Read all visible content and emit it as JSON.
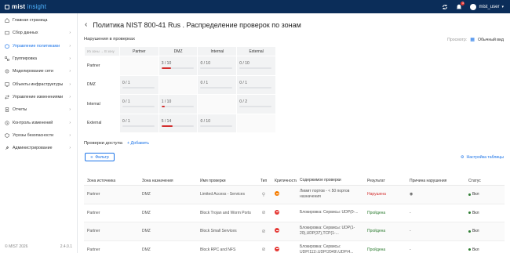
{
  "app": {
    "name": "mist",
    "name_accent": "insight"
  },
  "user": {
    "name": "mist_user",
    "notifications": "3"
  },
  "sidebar": {
    "items": [
      {
        "label": "Главная страница",
        "icon": "home-icon",
        "chevron": false
      },
      {
        "label": "Сбор данных",
        "icon": "download-icon",
        "chevron": true
      },
      {
        "label": "Управление политиками",
        "icon": "policy-icon",
        "chevron": true,
        "active": true
      },
      {
        "label": "Группировка",
        "icon": "group-icon",
        "chevron": true
      },
      {
        "label": "Моделирование сети",
        "icon": "network-icon",
        "chevron": true
      },
      {
        "label": "Объекты инфраструктуры",
        "icon": "infrastructure-icon",
        "chevron": true
      },
      {
        "label": "Управление изменениями",
        "icon": "changes-icon",
        "chevron": true
      },
      {
        "label": "Отчеты",
        "icon": "report-icon",
        "chevron": true
      },
      {
        "label": "Контроль изменений",
        "icon": "history-icon",
        "chevron": true
      },
      {
        "label": "Угрозы безопасности",
        "icon": "shield-icon",
        "chevron": true
      },
      {
        "label": "Администрирование",
        "icon": "tools-icon",
        "chevron": true
      }
    ],
    "footer_left": "© MIST 2026",
    "footer_right": "2.4.0.1"
  },
  "page": {
    "title": "Политика NIST 800-41 Rus . Распределение проверок по зонам",
    "violations_title": "Нарушения в проверках",
    "view_label": "Просмотр:",
    "view_value": "Обычный вид"
  },
  "matrix": {
    "corner": "Из зоны → В зону",
    "columns": [
      "Partner",
      "DMZ",
      "Internal",
      "External"
    ],
    "rows": [
      {
        "label": "Partner",
        "cells": [
          null,
          {
            "text": "3 / 10",
            "fraction": 0.3
          },
          {
            "text": "0 / 10",
            "fraction": 0
          },
          {
            "text": "0 / 10",
            "fraction": 0
          }
        ]
      },
      {
        "label": "DMZ",
        "cells": [
          {
            "text": "0 / 1",
            "fraction": 0
          },
          null,
          {
            "text": "0 / 1",
            "fraction": 0
          },
          {
            "text": "0 / 1",
            "fraction": 0
          }
        ]
      },
      {
        "label": "Internal",
        "cells": [
          {
            "text": "0 / 1",
            "fraction": 0
          },
          {
            "text": "1 / 10",
            "fraction": 0.1
          },
          null,
          {
            "text": "0 / 2",
            "fraction": 0
          }
        ]
      },
      {
        "label": "External",
        "cells": [
          {
            "text": "0 / 1",
            "fraction": 0
          },
          {
            "text": "5 / 14",
            "fraction": 0.357
          },
          {
            "text": "0 / 10",
            "fraction": 0
          },
          null
        ]
      }
    ]
  },
  "checks": {
    "title": "Проверки доступа",
    "add_label": "Добавить",
    "filter_label": "Фильтр",
    "table_settings_label": "Настройка таблицы",
    "columns": [
      "Зона источника",
      "Зона назначения",
      "Имя проверки",
      "Тип",
      "Критичность",
      "Содержимое проверки",
      "Результат",
      "Причина нарушения",
      "Статус"
    ],
    "rows": [
      {
        "source": "Partner",
        "dest": "DMZ",
        "name": "Limited Access - Services",
        "type_icon": "link-icon",
        "criticality": "med",
        "content": "Лимит портов - < 50 портов назначения",
        "result": "Нарушена",
        "result_kind": "red",
        "reason": "eye-icon",
        "status": "Вкл"
      },
      {
        "source": "Partner",
        "dest": "DMZ",
        "name": "Block Trojan and Worm Ports",
        "type_icon": "block-icon",
        "criticality": "high",
        "content": "Блокировка: Сервисы: UDP(0-...",
        "result": "Пройдена",
        "result_kind": "green",
        "reason": "-",
        "status": "Вкл"
      },
      {
        "source": "Partner",
        "dest": "DMZ",
        "name": "Block Small Services",
        "type_icon": "block-icon",
        "criticality": "high",
        "content": "Блокировка: Сервисы: UDP(1-20),UDP(37),TCP(1-...",
        "result": "Пройдена",
        "result_kind": "green",
        "reason": "-",
        "status": "Вкл"
      },
      {
        "source": "Partner",
        "dest": "DMZ",
        "name": "Block RPC and NFS",
        "type_icon": "block-icon",
        "criticality": "high",
        "content": "Блокировка: Сервисы: UDP(111),UDP(2049),UDP(4...",
        "result": "Пройдена",
        "result_kind": "green",
        "reason": "-",
        "status": "Вкл"
      }
    ]
  }
}
